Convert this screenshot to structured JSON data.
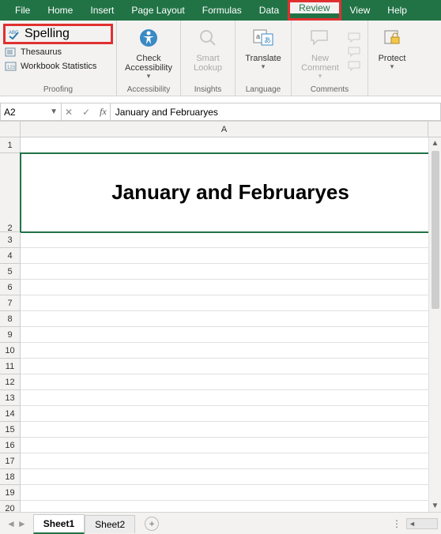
{
  "menus": {
    "file": "File",
    "home": "Home",
    "insert": "Insert",
    "page_layout": "Page Layout",
    "formulas": "Formulas",
    "data": "Data",
    "review": "Review",
    "view": "View",
    "help": "Help"
  },
  "ribbon": {
    "proofing": {
      "spelling": "Spelling",
      "thesaurus": "Thesaurus",
      "workbook_stats": "Workbook Statistics",
      "group_title": "Proofing"
    },
    "accessibility": {
      "label1": "Check",
      "label2": "Accessibility",
      "group_title": "Accessibility"
    },
    "insights": {
      "label1": "Smart",
      "label2": "Lookup",
      "group_title": "Insights"
    },
    "language": {
      "label": "Translate",
      "group_title": "Language"
    },
    "comments": {
      "label1": "New",
      "label2": "Comment",
      "group_title": "Comments"
    },
    "protect": {
      "label": "Protect"
    }
  },
  "namebox": {
    "value": "A2"
  },
  "formula_bar": {
    "fx": "fx",
    "value": "January and Februaryes"
  },
  "grid": {
    "col_label": "A",
    "rows": [
      "1",
      "2",
      "3",
      "4",
      "5",
      "6",
      "7",
      "8",
      "9",
      "10",
      "11",
      "12",
      "13",
      "14",
      "15",
      "16",
      "17",
      "18",
      "19",
      "20"
    ],
    "a2_value": "January and Februaryes"
  },
  "sheets": {
    "s1": "Sheet1",
    "s2": "Sheet2"
  }
}
